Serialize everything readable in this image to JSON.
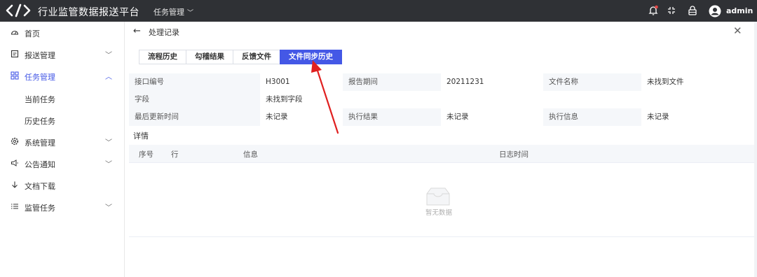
{
  "header": {
    "app_title": "行业监管数据报送平台",
    "menu_label": "任务管理",
    "user_name": "admin",
    "colors": {
      "bar_bg": "#2f3135",
      "notify_dot": "#e04747"
    }
  },
  "sidebar": {
    "items": [
      {
        "label": "首页",
        "icon": "dashboard-icon"
      },
      {
        "label": "报送管理",
        "icon": "document-icon"
      },
      {
        "label": "任务管理",
        "icon": "grid-icon"
      },
      {
        "label": "当前任务"
      },
      {
        "label": "历史任务"
      },
      {
        "label": "系统管理",
        "icon": "gear-icon"
      },
      {
        "label": "公告通知",
        "icon": "megaphone-icon"
      },
      {
        "label": "文档下载",
        "icon": "download-icon"
      },
      {
        "label": "监管任务",
        "icon": "list-icon"
      }
    ]
  },
  "panel": {
    "title": "处理记录",
    "tabs": [
      {
        "label": "流程历史"
      },
      {
        "label": "勾稽结果"
      },
      {
        "label": "反馈文件"
      },
      {
        "label": "文件同步历史",
        "active": true
      }
    ],
    "info": {
      "r1": {
        "k1": "接口编号",
        "v1": "H3001",
        "k2": "报告期间",
        "v2": "20211231",
        "k3": "文件名称",
        "v3": "未找到文件"
      },
      "r2": {
        "k1": "字段",
        "v1": "未找到字段"
      },
      "r3": {
        "k1": "最后更新时间",
        "v1": "未记录",
        "k2": "执行结果",
        "v2": "未记录",
        "k3": "执行信息",
        "v3": "未记录"
      }
    },
    "detail_label": "详情",
    "table_headers": [
      "序号",
      "行",
      "信息",
      "日志时间"
    ],
    "empty_text": "暂无数据",
    "accent_color": "#4458e6",
    "annotation_color": "#e02020"
  }
}
